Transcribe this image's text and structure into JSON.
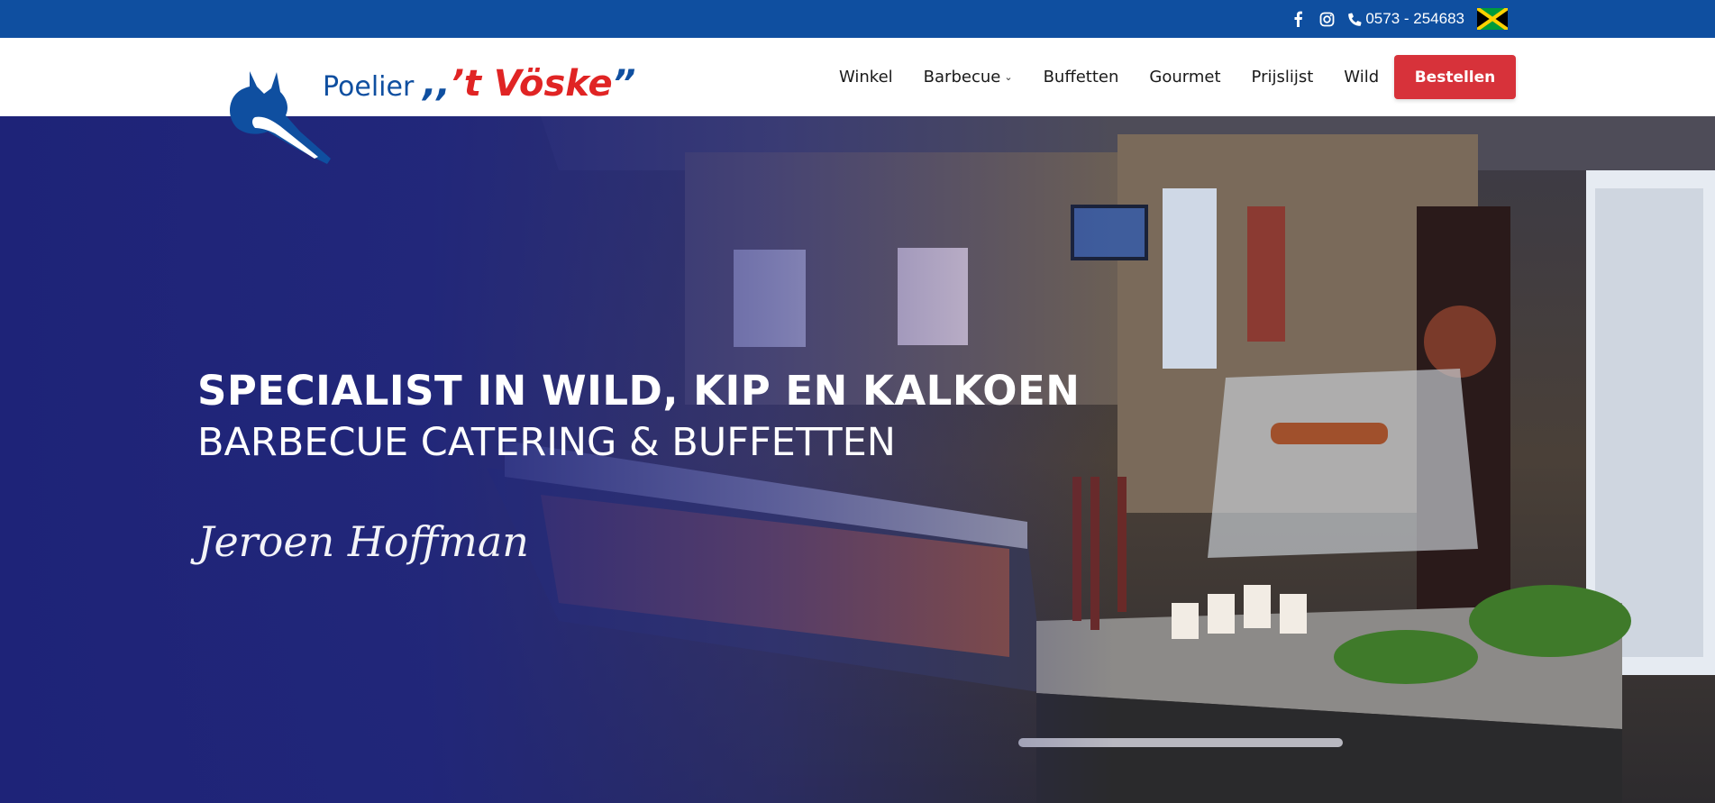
{
  "topbar": {
    "phone": "0573 - 254683",
    "social": [
      "facebook-icon",
      "instagram-icon"
    ],
    "flag": "jamaica-flag"
  },
  "brand": {
    "prefix": "Poelier",
    "open_quote": ",,",
    "name": "’t Vöske",
    "close_quote": "”"
  },
  "nav": {
    "items": [
      {
        "label": "Winkel"
      },
      {
        "label": "Barbecue",
        "has_dropdown": true
      },
      {
        "label": "Buffetten"
      },
      {
        "label": "Gourmet"
      },
      {
        "label": "Prijslijst"
      },
      {
        "label": "Wild"
      }
    ],
    "order_label": "Bestellen"
  },
  "hero": {
    "title": "SPECIALIST IN WILD, KIP EN KALKOEN",
    "subtitle": "BARBECUE CATERING & BUFFETTEN",
    "signature": "Jeroen Hoffman"
  },
  "colors": {
    "topbar": "#0f4fa0",
    "accent": "#d7323a",
    "brand_red": "#e02424",
    "brand_blue": "#0f4fa0"
  }
}
